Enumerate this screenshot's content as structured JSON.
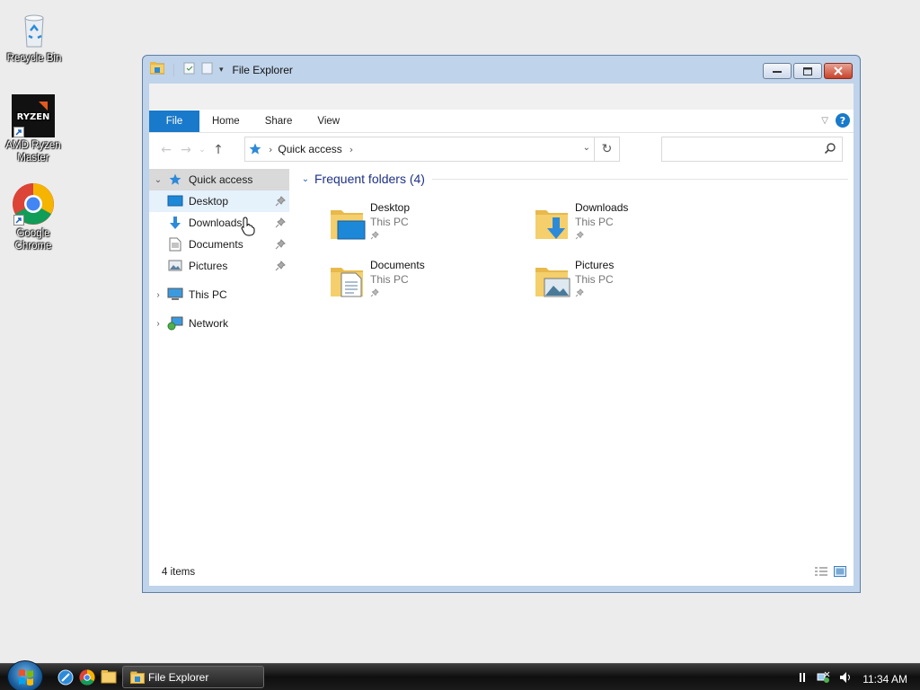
{
  "desktop": {
    "icons": [
      {
        "label": "Recycle Bin"
      },
      {
        "label": "AMD Ryzen Master",
        "logo_text": "RYZEN"
      },
      {
        "label": "Google Chrome"
      }
    ]
  },
  "window": {
    "title": "File Explorer",
    "ribbon_tabs": [
      "File",
      "Home",
      "Share",
      "View"
    ],
    "help_label": "?",
    "address": {
      "crumb": "Quick access",
      "search_placeholder": ""
    },
    "nav": {
      "quick_access": "Quick access",
      "pinned": [
        "Desktop",
        "Downloads",
        "Documents",
        "Pictures"
      ],
      "this_pc": "This PC",
      "network": "Network"
    },
    "content": {
      "group_title": "Frequent folders (4)",
      "folders": [
        {
          "name": "Desktop",
          "location": "This PC",
          "icon": "desktop-folder-icon"
        },
        {
          "name": "Downloads",
          "location": "This PC",
          "icon": "downloads-folder-icon"
        },
        {
          "name": "Documents",
          "location": "This PC",
          "icon": "documents-folder-icon"
        },
        {
          "name": "Pictures",
          "location": "This PC",
          "icon": "pictures-folder-icon"
        }
      ]
    },
    "status": "4 items"
  },
  "taskbar": {
    "task_label": "File Explorer",
    "clock": "11:34 AM"
  },
  "colors": {
    "accent": "#1979ca",
    "folder": "#f4cf6c",
    "group_title": "#1e3287"
  }
}
